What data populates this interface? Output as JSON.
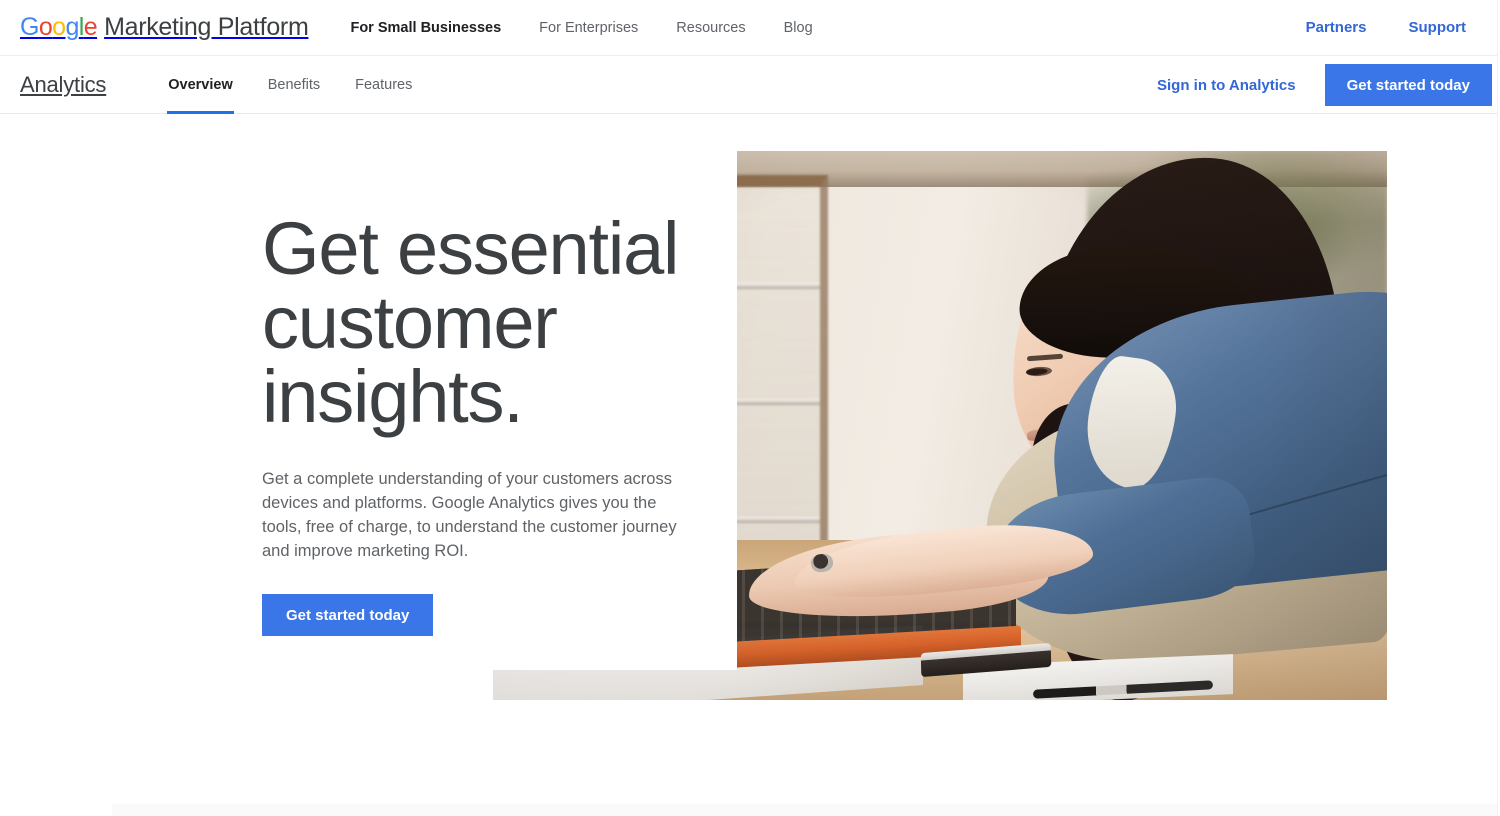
{
  "platform_bar": {
    "brand": {
      "google_letters": [
        "G",
        "o",
        "o",
        "g",
        "l",
        "e"
      ],
      "suffix": "Marketing Platform"
    },
    "nav": [
      {
        "label": "For Small Businesses",
        "active": true
      },
      {
        "label": "For Enterprises",
        "active": false
      },
      {
        "label": "Resources",
        "active": false
      },
      {
        "label": "Blog",
        "active": false
      }
    ],
    "right_links": [
      {
        "label": "Partners"
      },
      {
        "label": "Support"
      }
    ],
    "link_color": "#3367d6"
  },
  "product_bar": {
    "title": "Analytics",
    "tabs": [
      {
        "label": "Overview",
        "active": true
      },
      {
        "label": "Benefits",
        "active": false
      },
      {
        "label": "Features",
        "active": false
      }
    ],
    "signin_label": "Sign in to Analytics",
    "cta_label": "Get started today",
    "active_underline_color": "#1a73e8",
    "cta_color": "#3b76e8"
  },
  "hero": {
    "heading": "Get essential customer insights.",
    "subtext": "Get a complete understanding of your customers across devices and platforms. Google Analytics gives you the tools, free of charge, to understand the customer journey and improve marketing ROI.",
    "cta_label": "Get started today",
    "heading_color": "#3c4043",
    "subtext_color": "#5f6368",
    "image_alt": "Woman with dark hair in a denim jacket and beige apron typing on a laptop at a wooden counter in a shop"
  }
}
